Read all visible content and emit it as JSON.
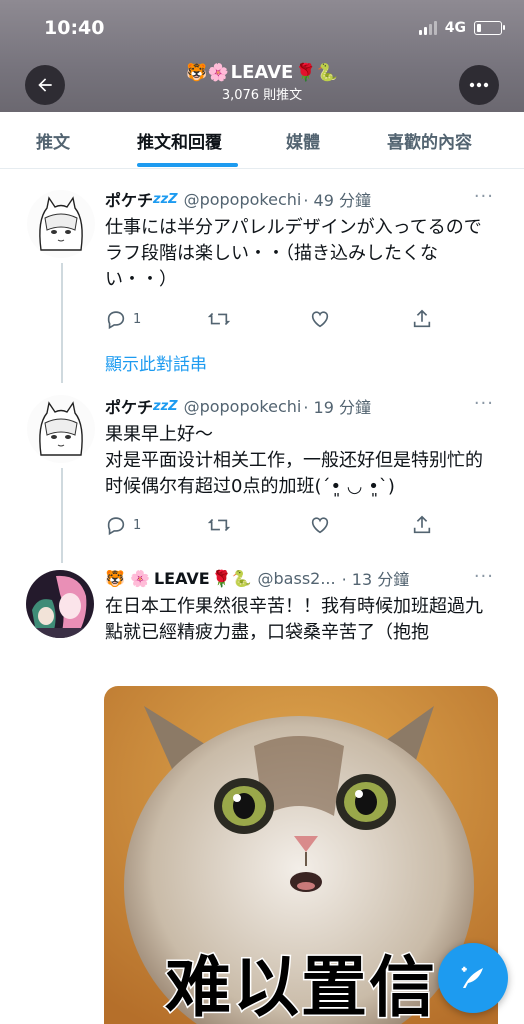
{
  "status_bar": {
    "time": "10:40",
    "network": "4G"
  },
  "header": {
    "title_prefix": "🐯🌸",
    "title_name": "LEAVE",
    "title_suffix": "🌹🐍",
    "subtitle": "3,076 則推文"
  },
  "tabs": [
    {
      "label": "推文",
      "active": false
    },
    {
      "label": "推文和回覆",
      "active": true
    },
    {
      "label": "媒體",
      "active": false
    },
    {
      "label": "喜歡的內容",
      "active": false
    }
  ],
  "tweets": [
    {
      "name": "ポケチ",
      "name_suffix": "zzZ",
      "handle": "@popopokechi",
      "time": "· 49 分鐘",
      "text": "仕事には半分アパレルデザインが入ってるのでラフ段階は楽しい・・（描き込みしたくない・・）",
      "replies": "1"
    },
    {
      "name": "ポケチ",
      "name_suffix": "zzZ",
      "handle": "@popopokechi",
      "time": "· 19 分鐘",
      "text_line1": "果果早上好～",
      "text_line2": "对是平面设计相关工作，一般还好但是特别忙的时候偶尔有超过0点的加班(ˊ•͈ ◡ •͈ˋ)",
      "replies": "1"
    },
    {
      "name_prefix": "🐯 🌸",
      "name": "LEAVE",
      "name_suffix": "🌹🐍",
      "handle": "@bass2...",
      "time": "· 13 分鐘",
      "text": "在日本工作果然很辛苦！！我有時候加班超過九點就已經精疲力盡，口袋桑辛苦了（抱抱",
      "media_caption": "难以置信"
    }
  ],
  "show_thread_label": "顯示此對話串",
  "colors": {
    "accent": "#1d9bf0",
    "text": "#0f1419",
    "secondary": "#536471",
    "header_bg": "#7a7780"
  },
  "icons": [
    "back-arrow-icon",
    "more-icon",
    "reply-icon",
    "retweet-icon",
    "like-icon",
    "share-icon",
    "compose-icon"
  ]
}
